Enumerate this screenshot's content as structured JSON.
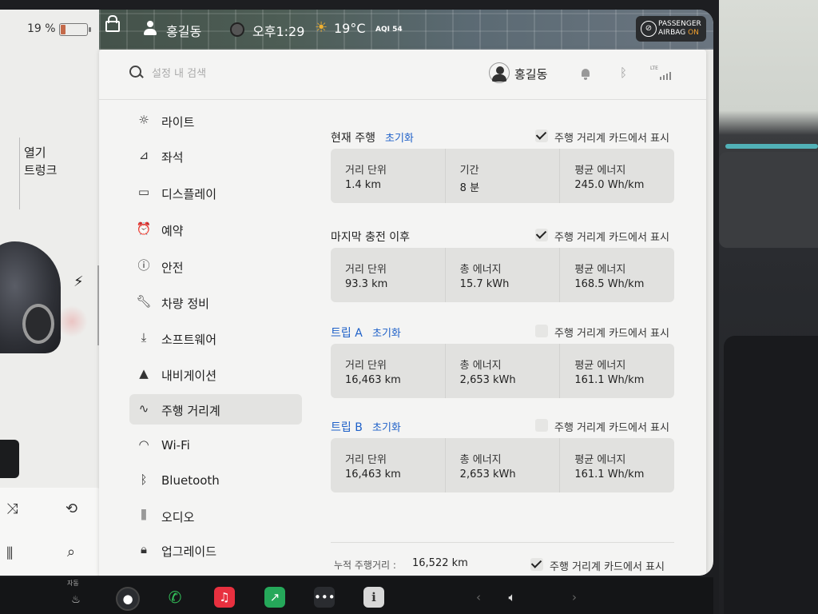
{
  "status": {
    "battery_pct": "19 %",
    "battery_fraction": 0.19,
    "user": "홍길동",
    "time": "오후1:29",
    "temperature": "19°C",
    "aqi": "AQI 54",
    "airbag_line1": "PASSENGER",
    "airbag_line2": "AIRBAG",
    "airbag_state": "ON"
  },
  "car_panel": {
    "trunk_open": "열기",
    "trunk": "트렁크"
  },
  "topbar": {
    "search_placeholder": "설정 내 검색",
    "username": "홍길동",
    "lte": "LTE"
  },
  "nav": {
    "items": [
      {
        "id": "lights",
        "label": "라이트",
        "icon": "sun-icon"
      },
      {
        "id": "seats",
        "label": "좌석",
        "icon": "seat-icon"
      },
      {
        "id": "display",
        "label": "디스플레이",
        "icon": "display-icon"
      },
      {
        "id": "schedule",
        "label": "예약",
        "icon": "alarm-icon"
      },
      {
        "id": "safety",
        "label": "안전",
        "icon": "alert-icon"
      },
      {
        "id": "service",
        "label": "차량 정비",
        "icon": "wrench-icon"
      },
      {
        "id": "software",
        "label": "소프트웨어",
        "icon": "download-icon"
      },
      {
        "id": "navigation",
        "label": "내비게이션",
        "icon": "navigation-icon"
      },
      {
        "id": "trips",
        "label": "주행 거리계",
        "icon": "trips-icon"
      },
      {
        "id": "wifi",
        "label": "Wi-Fi",
        "icon": "wifi-icon"
      },
      {
        "id": "bluetooth",
        "label": "Bluetooth",
        "icon": "bluetooth-icon"
      },
      {
        "id": "audio",
        "label": "오디오",
        "icon": "sliders-icon"
      },
      {
        "id": "upgrades",
        "label": "업그레이드",
        "icon": "lock-icon"
      }
    ],
    "active": "주행 거리계"
  },
  "trips": {
    "show_on_card_label": "주행 거리계 카드에서 표시",
    "reset_label": "초기화",
    "current": {
      "title": "현재 주행",
      "show_checked": true,
      "cells": [
        {
          "k": "거리 단위",
          "v": "1.4 km"
        },
        {
          "k": "기간",
          "v": "8 분"
        },
        {
          "k": "평균 에너지",
          "v": "245.0 Wh/km"
        }
      ]
    },
    "since_charge": {
      "title": "마지막 충전 이후",
      "show_checked": true,
      "cells": [
        {
          "k": "거리 단위",
          "v": "93.3 km"
        },
        {
          "k": "총 에너지",
          "v": "15.7 kWh"
        },
        {
          "k": "평균 에너지",
          "v": "168.5 Wh/km"
        }
      ]
    },
    "trip_a": {
      "title": "트립 A",
      "show_checked": false,
      "cells": [
        {
          "k": "거리 단위",
          "v": "16,463 km"
        },
        {
          "k": "총 에너지",
          "v": "2,653 kWh"
        },
        {
          "k": "평균 에너지",
          "v": "161.1 Wh/km"
        }
      ]
    },
    "trip_b": {
      "title": "트립 B",
      "show_checked": false,
      "cells": [
        {
          "k": "거리 단위",
          "v": "16,463 km"
        },
        {
          "k": "총 에너지",
          "v": "2,653 kWh"
        },
        {
          "k": "평균 에너지",
          "v": "161.1 Wh/km"
        }
      ]
    },
    "odometer_label": "누적 주행거리 :",
    "odometer_value": "16,522 km",
    "odometer_show_checked": true
  },
  "dock": {
    "auto_label": "자동"
  },
  "colors": {
    "accent": "#1e60c8",
    "battery": "#c46a4a",
    "airbag_on": "#f0a030"
  }
}
